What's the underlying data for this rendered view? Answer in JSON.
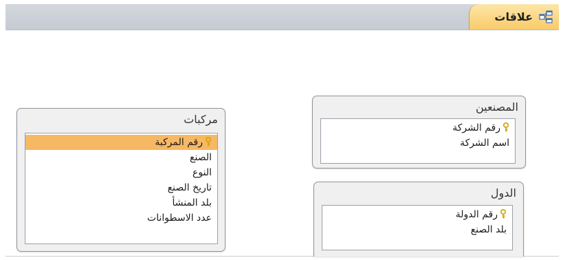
{
  "tab": {
    "label": "علاقات",
    "icon": "relationships-icon"
  },
  "colors": {
    "tab_bar": "#cbd0d7",
    "active_tab": "#fad485",
    "selected_field": "#f7b864",
    "key_icon": "#d4a80e"
  },
  "tables": {
    "vehicles": {
      "title": "مركبات",
      "fields": [
        {
          "label": "رقم المركبة",
          "primary_key": true,
          "selected": true
        },
        {
          "label": "الصنع",
          "primary_key": false
        },
        {
          "label": "النوع",
          "primary_key": false
        },
        {
          "label": "تاريخ الصنع",
          "primary_key": false
        },
        {
          "label": "بلد المنشأ",
          "primary_key": false
        },
        {
          "label": "عدد الاسطوانات",
          "primary_key": false
        }
      ]
    },
    "manufacturers": {
      "title": "المصنعين",
      "fields": [
        {
          "label": "رقم الشركة",
          "primary_key": true
        },
        {
          "label": "اسم الشركة",
          "primary_key": false
        }
      ]
    },
    "countries": {
      "title": "الدول",
      "fields": [
        {
          "label": "رقم الدولة",
          "primary_key": true
        },
        {
          "label": "بلد الصنع",
          "primary_key": false
        }
      ]
    }
  }
}
